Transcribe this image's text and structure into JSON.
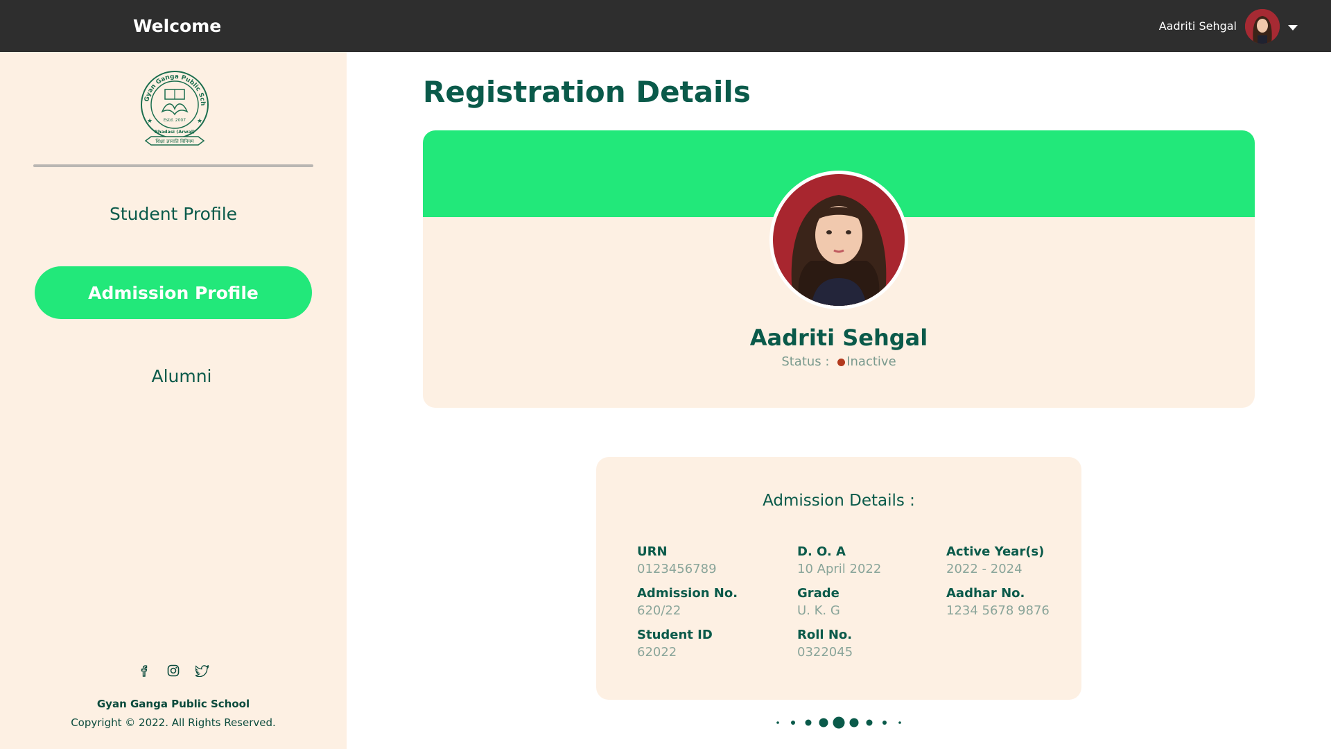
{
  "header": {
    "welcome": "Welcome",
    "user_name": "Aadriti Sehgal"
  },
  "sidebar": {
    "items": [
      {
        "label": "Student Profile",
        "active": false
      },
      {
        "label": "Admission Profile",
        "active": true
      },
      {
        "label": "Alumni",
        "active": false
      }
    ],
    "social_icons": [
      "facebook-icon",
      "instagram-icon",
      "twitter-icon"
    ],
    "school_name": "Gyan Ganga Public School",
    "copyright": "Copyright © 2022. All Rights Reserved."
  },
  "logo": {
    "school": "Gyan Ganga Public School",
    "estd": "Estd. 2007",
    "location": "Bhadasi (Arwal)",
    "motto": "शिक्षा ज्ञानाति विनियम"
  },
  "page": {
    "title": "Registration Details"
  },
  "profile": {
    "name": "Aadriti Sehgal",
    "status_label": "Status :",
    "status_value": "Inactive",
    "status_color": "#b2391d"
  },
  "admission": {
    "title": "Admission Details :",
    "fields": [
      {
        "label": "URN",
        "value": "0123456789"
      },
      {
        "label": "D. O. A",
        "value": "10 April 2022"
      },
      {
        "label": "Active Year(s)",
        "value": "2022 - 2024"
      },
      {
        "label": "Admission No.",
        "value": "620/22"
      },
      {
        "label": "Grade",
        "value": "U. K. G"
      },
      {
        "label": "Aadhar No.",
        "value": "1234 5678 9876"
      },
      {
        "label": "Student ID",
        "value": "62022"
      },
      {
        "label": "Roll No.",
        "value": "0322045"
      }
    ]
  },
  "colors": {
    "accent_green": "#22e87a",
    "dark_green": "#0a5a4a",
    "cream": "#fdf0e3",
    "topbar": "#2e2e2e"
  }
}
